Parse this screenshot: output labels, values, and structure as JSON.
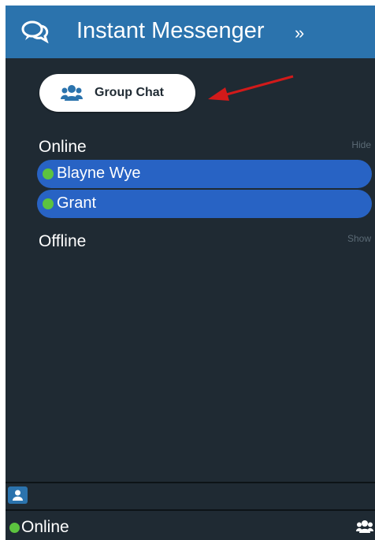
{
  "header": {
    "title": "Instant Messenger",
    "expand_glyph": "»",
    "icon": "chat-bubbles-icon"
  },
  "group_chat": {
    "label": "Group Chat",
    "icon": "group-icon"
  },
  "online_section": {
    "label": "Online",
    "action": "Hide",
    "contacts": [
      {
        "name": "Blayne Wye",
        "status": "online"
      },
      {
        "name": "Grant",
        "status": "online"
      }
    ]
  },
  "offline_section": {
    "label": "Offline",
    "action": "Show"
  },
  "footer": {
    "status_label": "Online",
    "user_tab_icon": "user-icon",
    "people_icon": "group-icon"
  },
  "colors": {
    "header": "#2b73ad",
    "panel": "#1f2a33",
    "contact_pill": "#2863c4",
    "online_dot": "#5cc33f",
    "annotation_arrow": "#d11a1a"
  }
}
